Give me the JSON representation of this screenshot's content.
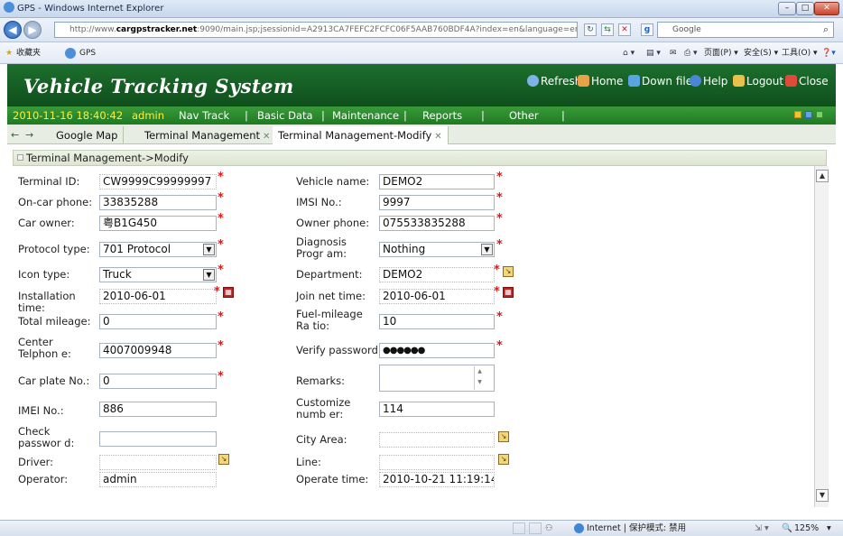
{
  "browser": {
    "title": "GPS - Windows Internet Explorer",
    "url_prefix": "http://www.",
    "url_domain": "cargpstracker.net",
    "url_rest": ":9090/main.jsp;jsessionid=A2913CA7FEFC2FCFC06F5AAB760BDF4A?index=en&language=en",
    "search_placeholder": "Google",
    "favorites_label": "收藏夹",
    "fav_tab": "GPS",
    "toolbar_page": "页面(P) ▾",
    "toolbar_safety": "安全(S) ▾",
    "toolbar_tools": "工具(O) ▾",
    "status_zone": "Internet | 保护模式: 禁用",
    "zoom": "125%"
  },
  "header": {
    "title": "Vehicle Tracking System",
    "links": [
      "Refresh",
      "Home",
      "Down file",
      "Help",
      "Logout",
      "Close"
    ]
  },
  "menu": {
    "datetime": "2010-11-16 18:40:42",
    "user": "admin",
    "items": [
      "Nav Track",
      "|",
      "Basic Data",
      "|",
      "Maintenance",
      "|",
      "Reports",
      "|",
      "Other",
      "|"
    ]
  },
  "tabs": [
    "Google Map",
    "Terminal Management",
    "Terminal Management-Modify"
  ],
  "breadcrumb": "Terminal Management->Modify",
  "form": {
    "terminal_id": {
      "label": "Terminal ID:",
      "value": "CW9999C99999997"
    },
    "oncar_phone": {
      "label": "On-car phone:",
      "value": "33835288"
    },
    "car_owner": {
      "label": "Car owner:",
      "value": "粤B1G450"
    },
    "protocol_type": {
      "label": "Protocol type:",
      "value": "701 Protocol"
    },
    "icon_type": {
      "label": "Icon type:",
      "value": "Truck"
    },
    "installation_time": {
      "label": "Installation time:",
      "value": "2010-06-01"
    },
    "total_mileage": {
      "label": "Total mileage:",
      "value": "0"
    },
    "center_telphone": {
      "label": "Center Telphon e:",
      "value": "4007009948"
    },
    "car_plate": {
      "label": "Car plate No.:",
      "value": "0"
    },
    "imei": {
      "label": "IMEI No.:",
      "value": "886"
    },
    "check_password": {
      "label": "Check passwor d:",
      "value": ""
    },
    "driver": {
      "label": "Driver:",
      "value": ""
    },
    "operator": {
      "label": "Operator:",
      "value": "admin"
    },
    "vehicle_name": {
      "label": "Vehicle name:",
      "value": "DEMO2"
    },
    "imsi": {
      "label": "IMSI No.:",
      "value": "9997"
    },
    "owner_phone": {
      "label": "Owner phone:",
      "value": "075533835288"
    },
    "diagnosis_program": {
      "label": "Diagnosis Progr am:",
      "value": "Nothing"
    },
    "department": {
      "label": "Department:",
      "value": "DEMO2"
    },
    "join_net_time": {
      "label": "Join net time:",
      "value": "2010-06-01"
    },
    "fuel_ratio": {
      "label": "Fuel-mileage Ra tio:",
      "value": "10"
    },
    "verify_password": {
      "label": "Verify password:",
      "value": "●●●●●●"
    },
    "remarks": {
      "label": "Remarks:",
      "value": ""
    },
    "customize_number": {
      "label": "Customize numb er:",
      "value": "114"
    },
    "city_area": {
      "label": "City Area:",
      "value": ""
    },
    "line": {
      "label": "Line:",
      "value": ""
    },
    "operate_time": {
      "label": "Operate time:",
      "value": "2010-10-21 11:19:14"
    }
  },
  "required_mark": "*",
  "colors": {
    "header_green": "#1d6f2e",
    "menu_green": "#2a8a2c",
    "datetime_yellow": "#ffef3a",
    "required_red": "#e01818"
  }
}
